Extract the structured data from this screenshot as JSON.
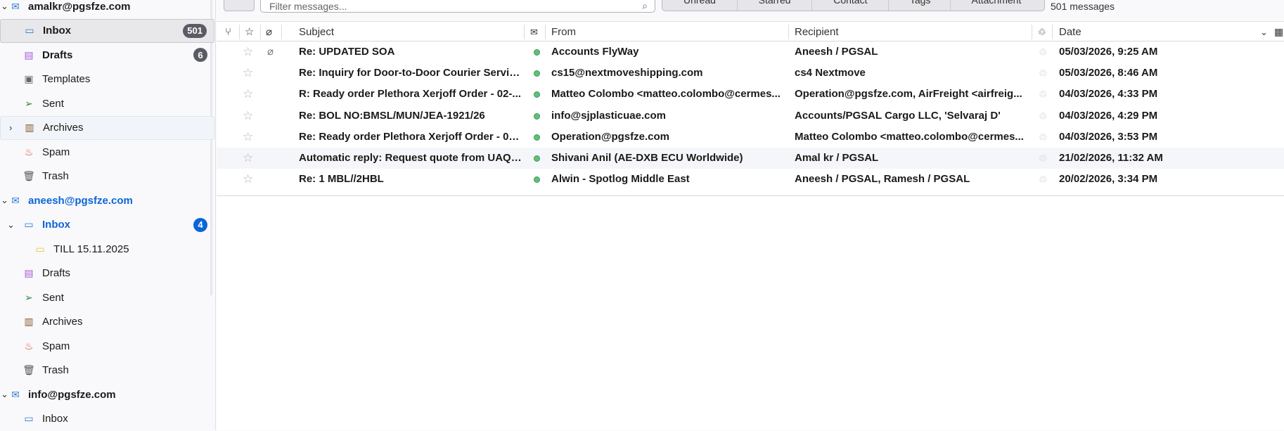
{
  "sidebar": {
    "accounts": [
      {
        "name": "amalkr@pgsfze.com",
        "folders": [
          {
            "label": "Inbox",
            "badge": "501",
            "icon": "inbox-icon"
          },
          {
            "label": "Drafts",
            "badge": "6",
            "icon": "drafts-icon"
          },
          {
            "label": "Templates",
            "icon": "templates-icon"
          },
          {
            "label": "Sent",
            "icon": "sent-icon"
          },
          {
            "label": "Archives",
            "icon": "archives-icon"
          },
          {
            "label": "Spam",
            "icon": "spam-icon"
          },
          {
            "label": "Trash",
            "icon": "trash-icon"
          }
        ]
      },
      {
        "name": "aneesh@pgsfze.com",
        "folders": [
          {
            "label": "Inbox",
            "badge": "4",
            "icon": "inbox-icon"
          },
          {
            "label": "TILL 15.11.2025",
            "icon": "folder-icon"
          },
          {
            "label": "Drafts",
            "icon": "drafts-icon"
          },
          {
            "label": "Sent",
            "icon": "sent-icon"
          },
          {
            "label": "Archives",
            "icon": "archives-icon"
          },
          {
            "label": "Spam",
            "icon": "spam-icon"
          },
          {
            "label": "Trash",
            "icon": "trash-icon"
          }
        ]
      },
      {
        "name": "info@pgsfze.com",
        "folders": [
          {
            "label": "Inbox",
            "icon": "inbox-icon"
          }
        ]
      }
    ]
  },
  "toolbar": {
    "filter_placeholder": "Filter messages...",
    "quick_filters": [
      "Unread",
      "Starred",
      "Contact",
      "Tags",
      "Attachment"
    ],
    "message_count": "501 messages"
  },
  "columns": {
    "subject": "Subject",
    "from": "From",
    "recipient": "Recipient",
    "date": "Date"
  },
  "messages": [
    {
      "subject": "Re: UPDATED SOA",
      "from": "Accounts FlyWay",
      "recipient": "Aneesh / PGSAL",
      "date": "05/03/2026, 9:25 AM",
      "attachment": true
    },
    {
      "subject": "Re: Inquiry for Door-to-Door Courier Servic...",
      "from": "cs15@nextmoveshipping.com",
      "recipient": "cs4 Nextmove",
      "date": "05/03/2026, 8:46 AM"
    },
    {
      "subject": "R: Ready order Plethora Xerjoff Order - 02-...",
      "from": "Matteo Colombo <matteo.colombo@cermes...",
      "recipient": "Operation@pgsfze.com, AirFreight <airfreig...",
      "date": "04/03/2026, 4:33 PM"
    },
    {
      "subject": "Re: BOL NO:BMSL/MUN/JEA-1921/26",
      "from": "info@sjplasticuae.com",
      "recipient": "Accounts/PGSAL Cargo LLC, 'Selvaraj D'",
      "date": "04/03/2026, 4:29 PM"
    },
    {
      "subject": "Re: Ready order Plethora Xerjoff Order - 02...",
      "from": "Operation@pgsfze.com",
      "recipient": "Matteo Colombo <matteo.colombo@cermes...",
      "date": "04/03/2026, 3:53 PM"
    },
    {
      "subject": "Automatic reply: Request quote from UAQ ...",
      "from": "Shivani Anil (AE-DXB ECU Worldwide)",
      "recipient": "Amal kr / PGSAL",
      "date": "21/02/2026, 11:32 AM"
    },
    {
      "subject": "Re: 1 MBL//2HBL",
      "from": "Alwin - Spotlog Middle East",
      "recipient": "Aneesh / PGSAL, Ramesh / PGSAL",
      "date": "20/02/2026, 3:34 PM"
    }
  ]
}
